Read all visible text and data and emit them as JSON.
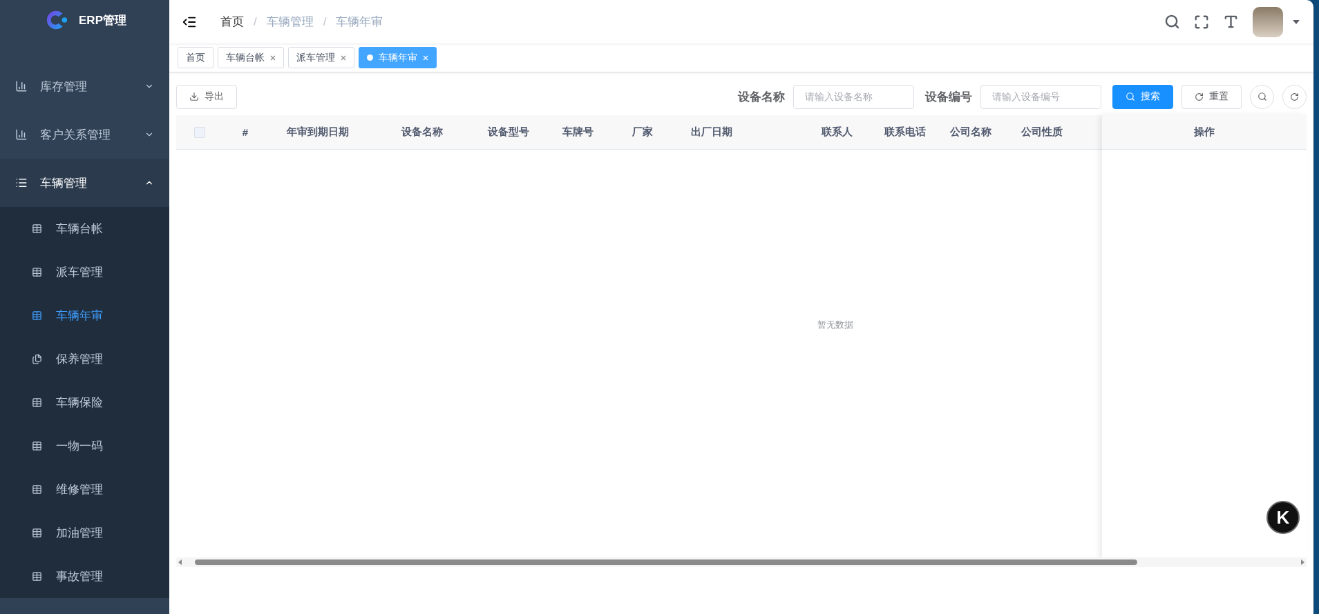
{
  "logo": {
    "title": "ERP管理"
  },
  "sidebar": {
    "items": [
      {
        "label": "库存管理",
        "expanded": false
      },
      {
        "label": "客户关系管理",
        "expanded": false
      },
      {
        "label": "车辆管理",
        "expanded": true,
        "children": [
          {
            "label": "车辆台帐",
            "selected": false
          },
          {
            "label": "派车管理",
            "selected": false
          },
          {
            "label": "车辆年审",
            "selected": true
          },
          {
            "label": "保养管理",
            "selected": false
          },
          {
            "label": "车辆保险",
            "selected": false
          },
          {
            "label": "一物一码",
            "selected": false
          },
          {
            "label": "维修管理",
            "selected": false
          },
          {
            "label": "加油管理",
            "selected": false
          },
          {
            "label": "事故管理",
            "selected": false
          }
        ]
      }
    ]
  },
  "breadcrumb_separator": "/",
  "breadcrumb": [
    {
      "label": "首页",
      "current": false
    },
    {
      "label": "车辆管理",
      "current": true
    },
    {
      "label": "车辆年审",
      "current": true
    }
  ],
  "tabs": [
    {
      "label": "首页",
      "closable": false,
      "selected": false
    },
    {
      "label": "车辆台帐",
      "closable": true,
      "selected": false
    },
    {
      "label": "派车管理",
      "closable": true,
      "selected": false
    },
    {
      "label": "车辆年审",
      "closable": true,
      "selected": true
    }
  ],
  "toolbar": {
    "export": "导出",
    "filters": [
      {
        "label": "设备名称",
        "placeholder": "请输入设备名称"
      },
      {
        "label": "设备编号",
        "placeholder": "请输入设备编号"
      }
    ],
    "search": "搜索",
    "reset": "重置"
  },
  "table": {
    "columns": [
      "#",
      "年审到期日期",
      "设备名称",
      "设备型号",
      "车牌号",
      "厂家",
      "出厂日期",
      "",
      "联系人",
      "联系电话",
      "公司名称",
      "公司性质"
    ],
    "fixed_column": "操作",
    "empty_text": "暂无数据",
    "select_all_checked": false
  },
  "floating_badge": "K"
}
